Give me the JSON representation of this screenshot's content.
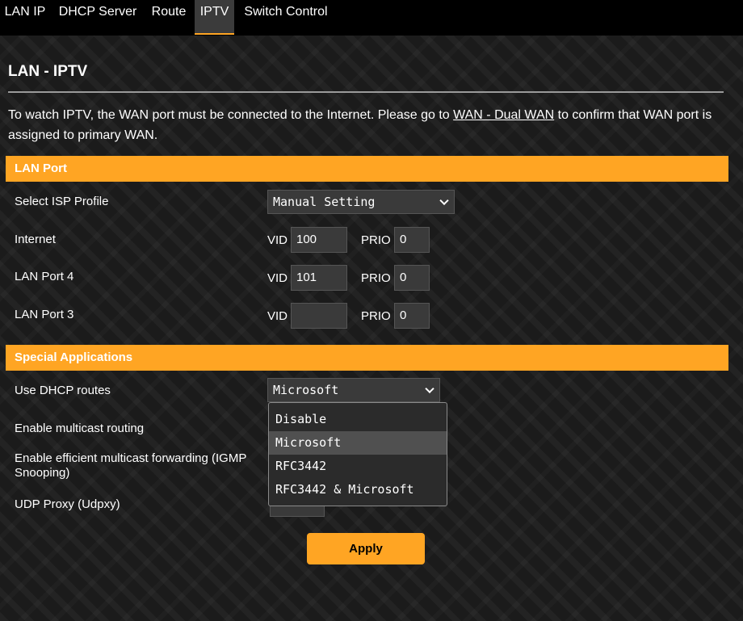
{
  "tabs": [
    "LAN IP",
    "DHCP Server",
    "Route",
    "IPTV",
    "Switch Control"
  ],
  "active_tab": "IPTV",
  "page_title": "LAN - IPTV",
  "intro": {
    "before": "To watch IPTV, the WAN port must be connected to the Internet. Please go to ",
    "link": "WAN - Dual WAN",
    "after": " to confirm that WAN port is assigned to primary WAN."
  },
  "lan_port": {
    "header": "LAN Port",
    "isp_profile_label": "Select ISP Profile",
    "isp_profile_value": "Manual Setting",
    "vid_label": "VID",
    "prio_label": "PRIO",
    "rows": [
      {
        "label": "Internet",
        "vid": "100",
        "prio": "0"
      },
      {
        "label": "LAN Port 4",
        "vid": "101",
        "prio": "0"
      },
      {
        "label": "LAN Port 3",
        "vid": "",
        "prio": "0"
      }
    ]
  },
  "special": {
    "header": "Special Applications",
    "dhcp_routes_label": "Use DHCP routes",
    "dhcp_routes_value": "Microsoft",
    "multicast_label": "Enable multicast routing",
    "igmp_label": "Enable efficient multicast forwarding (IGMP Snooping)",
    "udp_proxy_label": "UDP Proxy (Udpxy)",
    "dropdown_options": [
      "Disable",
      "Microsoft",
      "RFC3442",
      "RFC3442 & Microsoft"
    ],
    "dropdown_selected": "Microsoft"
  },
  "apply_label": "Apply",
  "colors": {
    "accent": "#ffa523",
    "background": "#1b1b1b",
    "tabbar": "#000000"
  },
  "icons": [
    "chevron-down-icon"
  ]
}
